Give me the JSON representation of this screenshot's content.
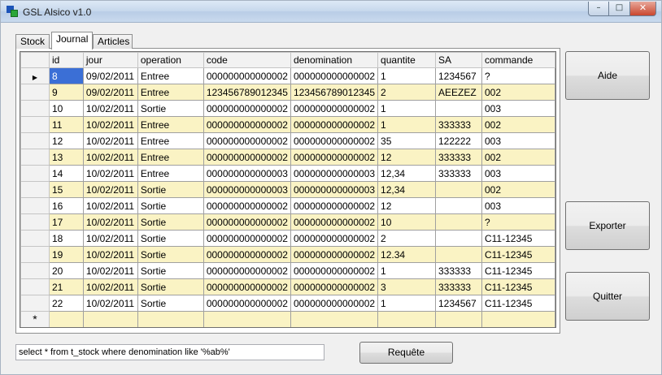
{
  "window": {
    "title": "GSL Alsico v1.0"
  },
  "title_buttons": {
    "minimize": "–",
    "maximize": "□",
    "close": "✕"
  },
  "tabs": [
    {
      "label": "Stock"
    },
    {
      "label": "Journal",
      "active": true
    },
    {
      "label": "Articles"
    }
  ],
  "grid": {
    "columns": [
      "id",
      "jour",
      "operation",
      "code",
      "denomination",
      "quantite",
      "SA",
      "commande"
    ],
    "current_row_marker": "▶",
    "new_row_marker": "*",
    "rows": [
      [
        "8",
        "09/02/2011",
        "Entree",
        "000000000000002",
        "000000000000002",
        "1",
        "1234567",
        "?"
      ],
      [
        "9",
        "09/02/2011",
        "Entree",
        "123456789012345",
        "123456789012345",
        "2",
        "AEEZEZ",
        "002"
      ],
      [
        "10",
        "10/02/2011",
        "Sortie",
        "000000000000002",
        "000000000000002",
        "1",
        "",
        "003"
      ],
      [
        "11",
        "10/02/2011",
        "Entree",
        "000000000000002",
        "000000000000002",
        "1",
        "333333",
        "002"
      ],
      [
        "12",
        "10/02/2011",
        "Entree",
        "000000000000002",
        "000000000000002",
        "35",
        "122222",
        "003"
      ],
      [
        "13",
        "10/02/2011",
        "Entree",
        "000000000000002",
        "000000000000002",
        "12",
        "333333",
        "002"
      ],
      [
        "14",
        "10/02/2011",
        "Entree",
        "000000000000003",
        "000000000000003",
        "12,34",
        "333333",
        "003"
      ],
      [
        "15",
        "10/02/2011",
        "Sortie",
        "000000000000003",
        "000000000000003",
        "12,34",
        "",
        "002"
      ],
      [
        "16",
        "10/02/2011",
        "Sortie",
        "000000000000002",
        "000000000000002",
        "12",
        "",
        "003"
      ],
      [
        "17",
        "10/02/2011",
        "Sortie",
        "000000000000002",
        "000000000000002",
        "10",
        "",
        "?"
      ],
      [
        "18",
        "10/02/2011",
        "Sortie",
        "000000000000002",
        "000000000000002",
        "2",
        "",
        "C11-12345"
      ],
      [
        "19",
        "10/02/2011",
        "Sortie",
        "000000000000002",
        "000000000000002",
        "12.34",
        "",
        "C11-12345"
      ],
      [
        "20",
        "10/02/2011",
        "Sortie",
        "000000000000002",
        "000000000000002",
        "1",
        "333333",
        "C11-12345"
      ],
      [
        "21",
        "10/02/2011",
        "Sortie",
        "000000000000002",
        "000000000000002",
        "3",
        "333333",
        "C11-12345"
      ],
      [
        "22",
        "10/02/2011",
        "Sortie",
        "000000000000002",
        "000000000000002",
        "1",
        "1234567",
        "C11-12345"
      ]
    ]
  },
  "buttons": {
    "aide": "Aide",
    "exporter": "Exporter",
    "quitter": "Quitter",
    "requete": "Requête"
  },
  "query": {
    "value": "select * from t_stock where denomination like '%ab%'"
  },
  "colors": {
    "alt_row": "#faf3c4",
    "selection": "#3b6fd6",
    "title_bar": "#c7d8ec"
  }
}
